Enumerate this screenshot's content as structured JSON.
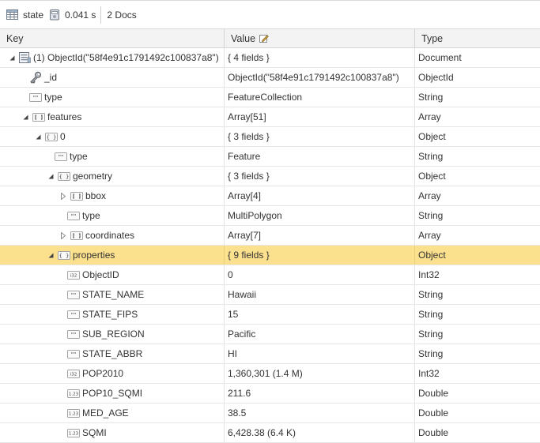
{
  "toolbar": {
    "collection": "state",
    "time": "0.041 s",
    "docs": "2 Docs"
  },
  "columns": {
    "key": "Key",
    "value": "Value",
    "type": "Type"
  },
  "rows": [
    {
      "key": "(1) ObjectId(\"58f4e91c1791492c100837a8\")",
      "value": "{ 4 fields }",
      "type": "Document",
      "icon": "document-icon",
      "toggle": "expanded"
    },
    {
      "key": "_id",
      "value": "ObjectId(\"58f4e91c1791492c100837a8\")",
      "type": "ObjectId",
      "icon": "key-icon",
      "toggle": "none"
    },
    {
      "key": "type",
      "value": "FeatureCollection",
      "type": "String",
      "icon": "string-icon",
      "toggle": "none"
    },
    {
      "key": "features",
      "value": "Array[51]",
      "type": "Array",
      "icon": "array-icon",
      "toggle": "expanded"
    },
    {
      "key": "0",
      "value": "{ 3 fields }",
      "type": "Object",
      "icon": "object-icon",
      "toggle": "expanded"
    },
    {
      "key": "type",
      "value": "Feature",
      "type": "String",
      "icon": "string-icon",
      "toggle": "none"
    },
    {
      "key": "geometry",
      "value": "{ 3 fields }",
      "type": "Object",
      "icon": "object-icon",
      "toggle": "expanded"
    },
    {
      "key": "bbox",
      "value": "Array[4]",
      "type": "Array",
      "icon": "array-icon",
      "toggle": "collapsed"
    },
    {
      "key": "type",
      "value": "MultiPolygon",
      "type": "String",
      "icon": "string-icon",
      "toggle": "none"
    },
    {
      "key": "coordinates",
      "value": "Array[7]",
      "type": "Array",
      "icon": "array-icon",
      "toggle": "collapsed"
    },
    {
      "key": "properties",
      "value": "{ 9 fields }",
      "type": "Object",
      "icon": "object-icon",
      "toggle": "expanded",
      "selected": true
    },
    {
      "key": "ObjectID",
      "value": "0",
      "type": "Int32",
      "icon": "int32-icon",
      "toggle": "none"
    },
    {
      "key": "STATE_NAME",
      "value": "Hawaii",
      "type": "String",
      "icon": "string-icon",
      "toggle": "none"
    },
    {
      "key": "STATE_FIPS",
      "value": "15",
      "type": "String",
      "icon": "string-icon",
      "toggle": "none"
    },
    {
      "key": "SUB_REGION",
      "value": "Pacific",
      "type": "String",
      "icon": "string-icon",
      "toggle": "none"
    },
    {
      "key": "STATE_ABBR",
      "value": "HI",
      "type": "String",
      "icon": "string-icon",
      "toggle": "none"
    },
    {
      "key": "POP2010",
      "value": "1,360,301 (1.4 M)",
      "type": "Int32",
      "icon": "int32-icon",
      "toggle": "none"
    },
    {
      "key": "POP10_SQMI",
      "value": "211.6",
      "type": "Double",
      "icon": "double-icon",
      "toggle": "none"
    },
    {
      "key": "MED_AGE",
      "value": "38.5",
      "type": "Double",
      "icon": "double-icon",
      "toggle": "none"
    },
    {
      "key": "SQMI",
      "value": "6,428.38 (6.4 K)",
      "type": "Double",
      "icon": "double-icon",
      "toggle": "none"
    }
  ]
}
